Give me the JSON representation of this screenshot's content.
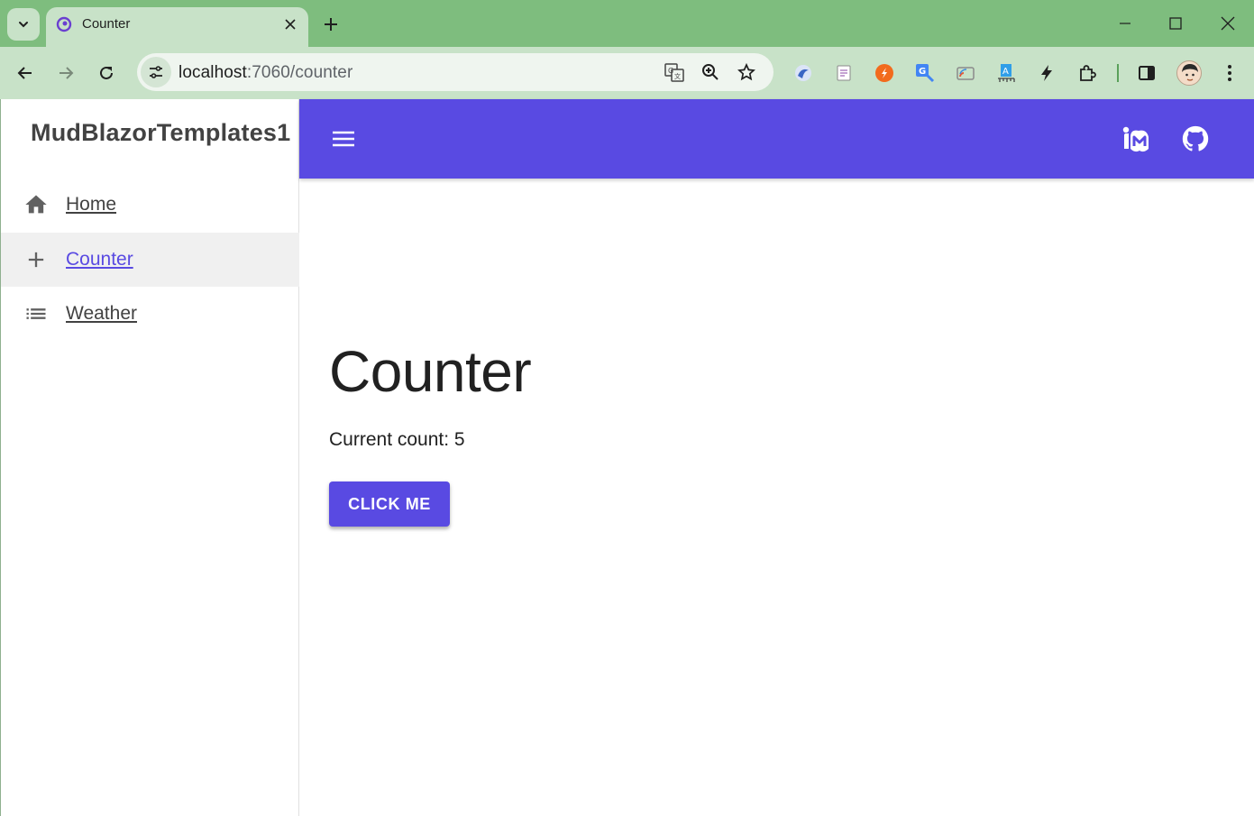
{
  "browser": {
    "tab_title": "Counter",
    "url_host": "localhost",
    "url_path": ":7060/counter",
    "accent_color": "#7ebd7e"
  },
  "drawer": {
    "brand": "MudBlazorTemplates1",
    "items": [
      {
        "label": "Home",
        "icon": "home-icon",
        "active": false
      },
      {
        "label": "Counter",
        "icon": "add-icon",
        "active": true
      },
      {
        "label": "Weather",
        "icon": "list-icon",
        "active": false
      }
    ]
  },
  "appbar": {
    "color": "#594ae2",
    "icons": [
      "menu-icon",
      "mudblazor-icon",
      "github-icon"
    ]
  },
  "main": {
    "title": "Counter",
    "count_text": "Current count: 5",
    "button_label": "CLICK ME"
  }
}
